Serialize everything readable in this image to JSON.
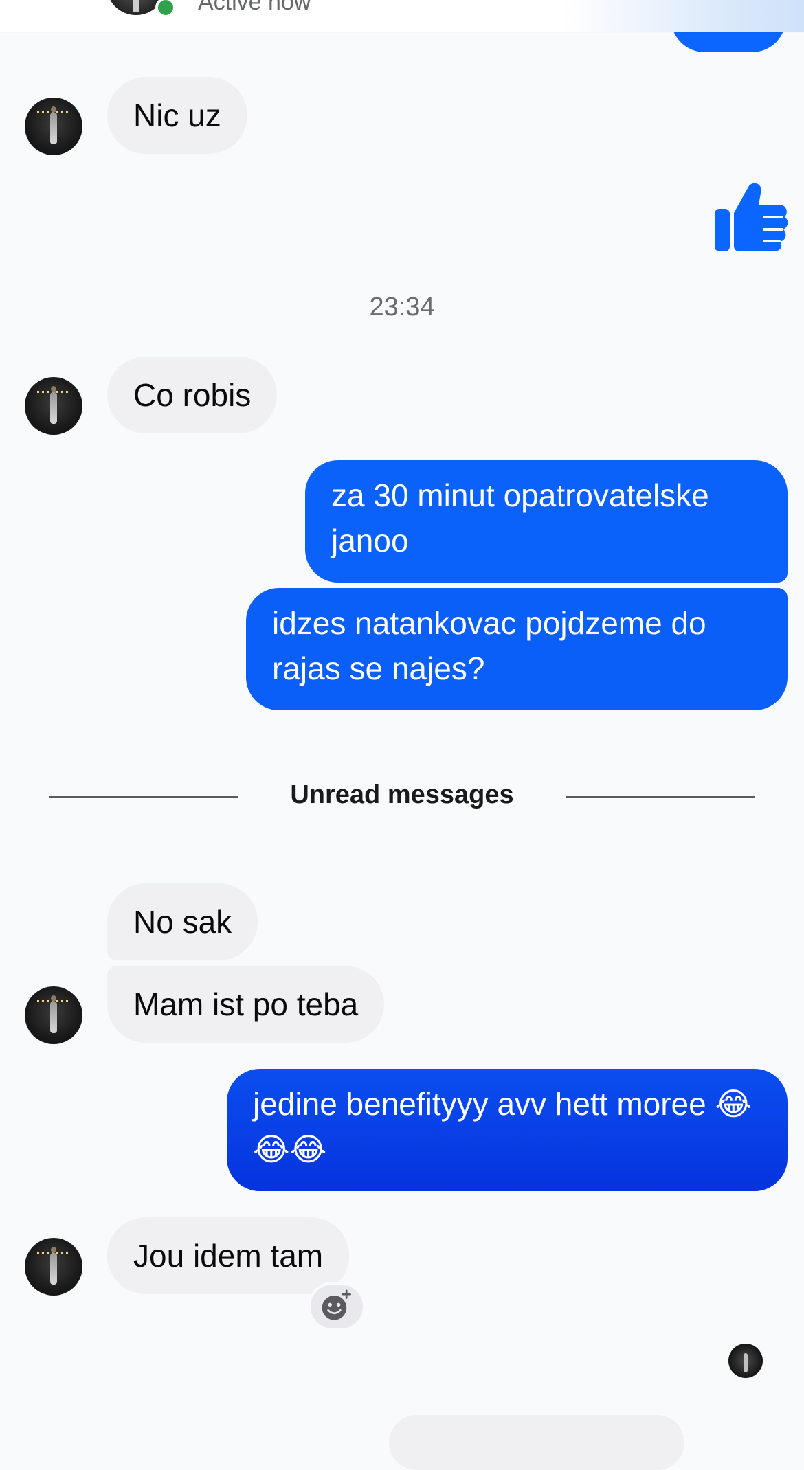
{
  "header": {
    "status": "Active now"
  },
  "messages": {
    "m1": "Nic uz",
    "time": "23:34",
    "m2": "Co robis",
    "m3": "za 30 minut opatrovatelske janoo",
    "m4": "idzes natankovac pojdzeme do rajas se najes?",
    "unread": "Unread messages",
    "m5": "No sak",
    "m6": "Mam ist po teba",
    "m7": "jedine benefityyy avv hett moree 😂😂😂",
    "m8": "Jou idem tam"
  },
  "icons": {
    "like": "thumbs-up-icon",
    "react": "add-reaction-icon",
    "online": "online-status-dot"
  },
  "colors": {
    "accent": "#0a66ff",
    "incoming_bubble": "#f0f0f3",
    "online": "#31a24c"
  }
}
